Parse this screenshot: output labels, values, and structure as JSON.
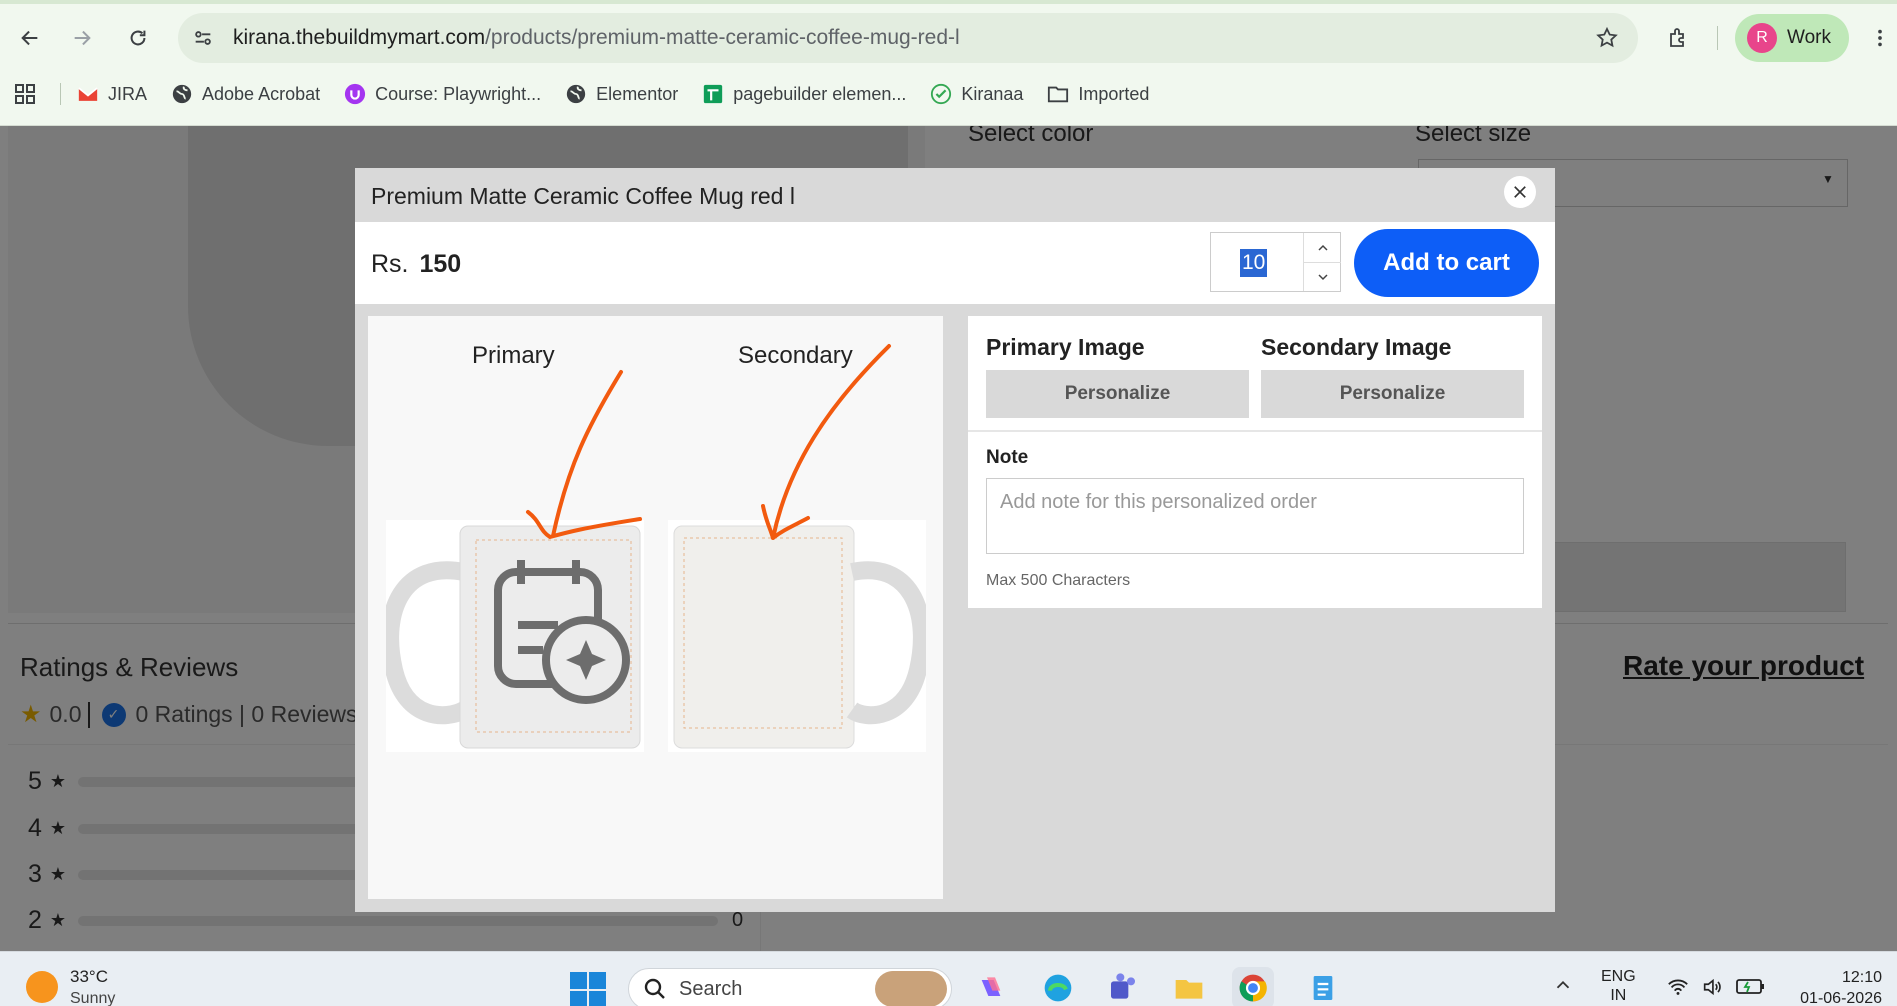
{
  "browser": {
    "url_domain": "kirana.thebuildmymart.com",
    "url_path": "/products/premium-matte-ceramic-coffee-mug-red-l",
    "profile_initial": "R",
    "profile_label": "Work",
    "bookmarks": [
      {
        "label": "JIRA",
        "icon": "gmail-icon"
      },
      {
        "label": "Adobe Acrobat",
        "icon": "globe-icon"
      },
      {
        "label": "Course: Playwright...",
        "icon": "course-icon"
      },
      {
        "label": "Elementor",
        "icon": "globe-icon"
      },
      {
        "label": "pagebuilder elemen...",
        "icon": "sheets-icon"
      },
      {
        "label": "Kiranaa",
        "icon": "check-icon"
      },
      {
        "label": "Imported",
        "icon": "folder-icon"
      }
    ]
  },
  "page": {
    "select_color_label": "Select color",
    "select_size_label": "Select size",
    "reviews_title": "Ratings & Reviews",
    "rate_link": "Rate your product",
    "score": "0.0",
    "ratings_summary": "0 Ratings | 0 Reviews",
    "rating_rows": [
      {
        "stars": "5",
        "count": ""
      },
      {
        "stars": "4",
        "count": ""
      },
      {
        "stars": "3",
        "count": ""
      },
      {
        "stars": "2",
        "count": "0"
      }
    ]
  },
  "modal": {
    "title": "Premium Matte Ceramic Coffee Mug red l",
    "price_prefix": "Rs.",
    "price_value": "150",
    "quantity": "10",
    "add_to_cart": "Add to cart",
    "preview_primary_label": "Primary",
    "preview_secondary_label": "Secondary",
    "primary_image_label": "Primary Image",
    "secondary_image_label": "Secondary Image",
    "personalize_label": "Personalize",
    "note_label": "Note",
    "note_placeholder": "Add note for this personalized order",
    "note_hint": "Max 500 Characters",
    "annotation_color": "#f25a0f",
    "accent_color": "#0d5ef7"
  },
  "taskbar": {
    "temperature": "33°C",
    "condition": "Sunny",
    "search_label": "Search",
    "lang_line1": "ENG",
    "lang_line2": "IN",
    "time": "12:10",
    "date": "01-06-2026"
  }
}
